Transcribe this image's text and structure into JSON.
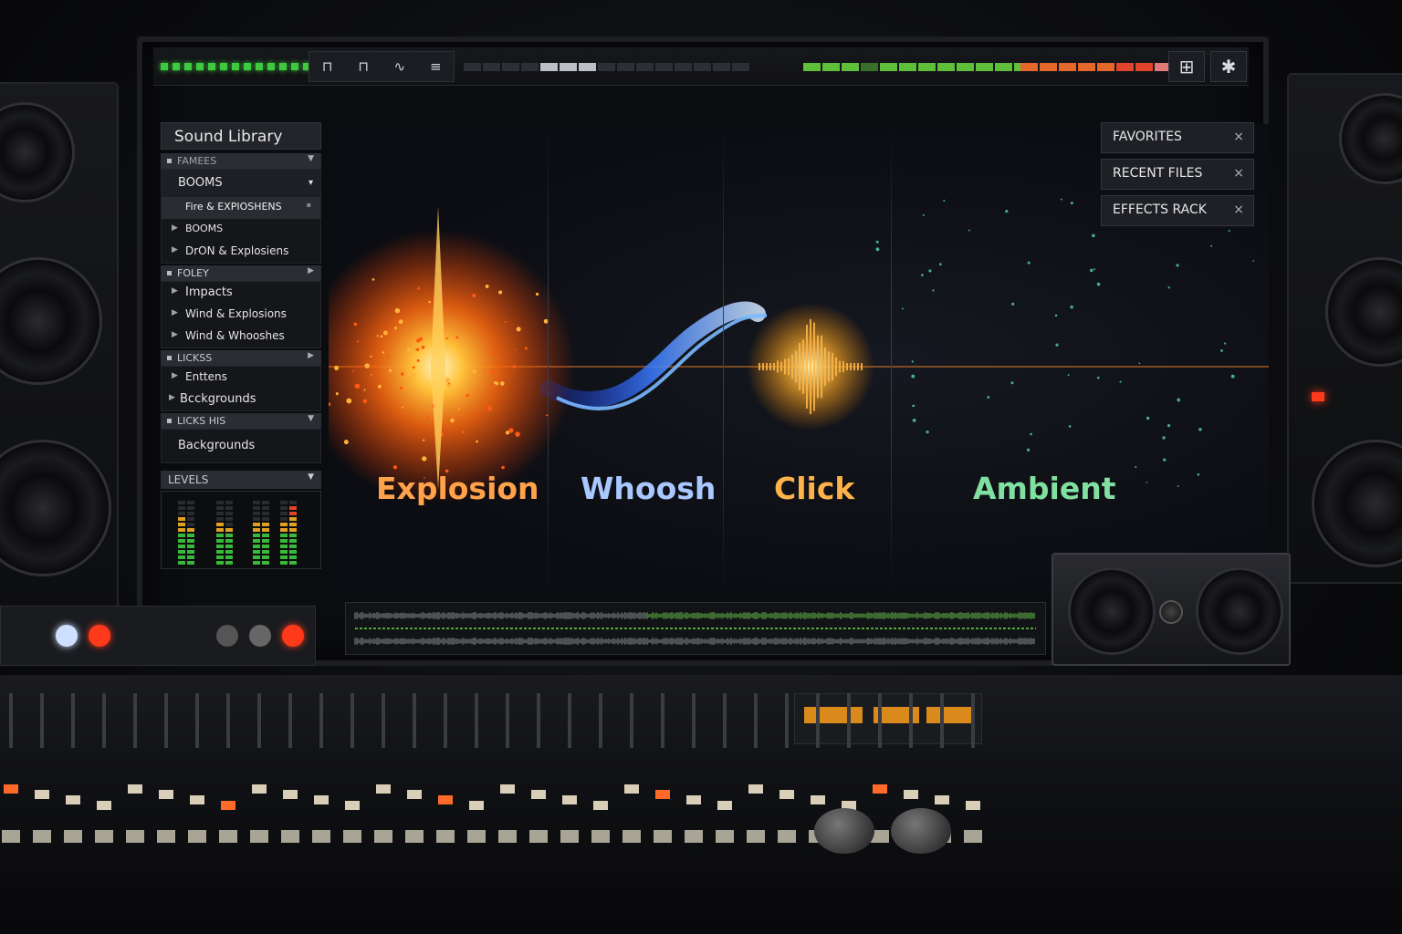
{
  "app": {
    "sidebar": {
      "title": "Sound Library",
      "sections": [
        {
          "header": "FAMEES"
        },
        {
          "header": "FOLEY"
        },
        {
          "header": "LICKSS"
        },
        {
          "header": "LICKS HIS"
        }
      ],
      "items": {
        "booms_category": "BOOMS",
        "fire_explosions": "Fire & EXPIOSHENS",
        "booms_sub": "BOOMS",
        "dron_explosiens": "DrON & Explosiens",
        "impacts": "Impacts",
        "wind_explosions": "Wind & Explosions",
        "wind_whooshes": "Wind & Whooshes",
        "enttens": "Enttens",
        "backgrounds_1": "Bcckgrounds",
        "backgrounds_2": "Backgrounds"
      },
      "levels": {
        "header": "LEVELS"
      }
    },
    "right_panel": {
      "buttons": [
        {
          "label": "FAVORITES",
          "close": "×"
        },
        {
          "label": "RECENT FILES",
          "close": "×"
        },
        {
          "label": "EFFECTS RACK",
          "close": "×"
        }
      ]
    },
    "canvas": {
      "effects": [
        {
          "label": "Explosion",
          "color": "#ffa24a"
        },
        {
          "label": "Whoosh",
          "color": "#a9c8ff"
        },
        {
          "label": "Click",
          "color": "#ffb24a"
        },
        {
          "label": "Ambient",
          "color": "#7fe0a0"
        }
      ]
    },
    "colors": {
      "accent_green": "#3ec93e",
      "accent_orange": "#ff7a1a",
      "accent_blue": "#3a7dff",
      "meter_red": "#e0452b"
    },
    "icons": {
      "toolbar": [
        "pin-icon",
        "pin-icon",
        "waveform-edit-icon",
        "list-menu-icon"
      ],
      "corner": [
        "grid-layout-icon",
        "star-burst-icon"
      ]
    }
  }
}
